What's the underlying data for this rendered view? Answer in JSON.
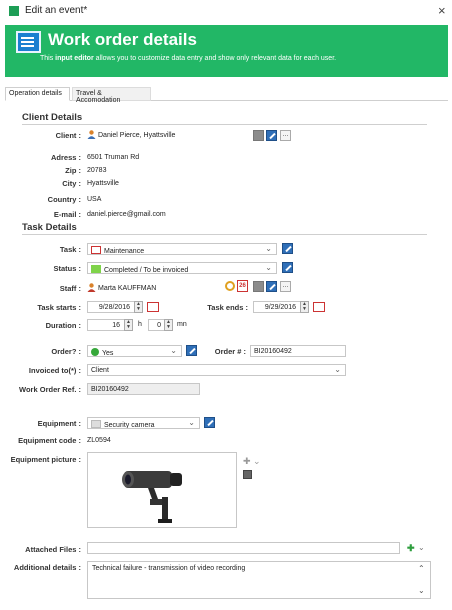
{
  "window": {
    "title": "Edit an event*",
    "close_glyph": "×"
  },
  "banner": {
    "title": "Work order details",
    "subtitle_pre": "This ",
    "subtitle_bold": "input editor",
    "subtitle_post": " allows you to customize data entry and show only relevant data for each user.",
    "color": "#22b766"
  },
  "tabs": [
    {
      "label": "Operation details",
      "active": true
    },
    {
      "label": "Travel & Accomodation",
      "active": false
    }
  ],
  "client": {
    "section": "Client Details",
    "client_label": "Client :",
    "client_value": "Daniel Pierce, Hyattsville",
    "address_label": "Adress :",
    "address_value": "6501 Truman Rd",
    "zip_label": "Zip :",
    "zip_value": "20783",
    "city_label": "City :",
    "city_value": "Hyattsville",
    "country_label": "Country :",
    "country_value": "USA",
    "email_label": "E-mail :",
    "email_value": "daniel.pierce@gmail.com"
  },
  "task": {
    "section": "Task Details",
    "task_label": "Task :",
    "task_value": "Maintenance",
    "status_label": "Status :",
    "status_value": "Completed / To be invoiced",
    "status_color": "#7fd34a",
    "staff_label": "Staff :",
    "staff_value": "Marta KAUFFMAN",
    "starts_label": "Task starts :",
    "starts_value": "9/28/2016",
    "ends_label": "Task ends :",
    "ends_value": "9/29/2016",
    "duration_label": "Duration :",
    "duration_hours": "16",
    "duration_h_unit": "h",
    "duration_minutes": "0",
    "duration_mn_unit": "mn",
    "calendar_day": "26"
  },
  "order": {
    "order_label": "Order? :",
    "order_value": "Yes",
    "order_num_label": "Order # :",
    "order_num_value": "BI20160492",
    "invoiced_label": "Invoiced to(*) :",
    "invoiced_value": "Client",
    "wo_ref_label": "Work Order Ref. :",
    "wo_ref_value": "BI20160492"
  },
  "equipment": {
    "equipment_label": "Equipment :",
    "equipment_value": "Security camera",
    "code_label": "Equipment code :",
    "code_value": "ZL0594",
    "picture_label": "Equipment picture :"
  },
  "attachments": {
    "files_label": "Attached Files :",
    "details_label": "Additional details :",
    "details_value": "Technical failure - transmission of video recording"
  },
  "icons": {
    "person": "person-icon",
    "pen": "pen-icon",
    "dots": "..."
  }
}
